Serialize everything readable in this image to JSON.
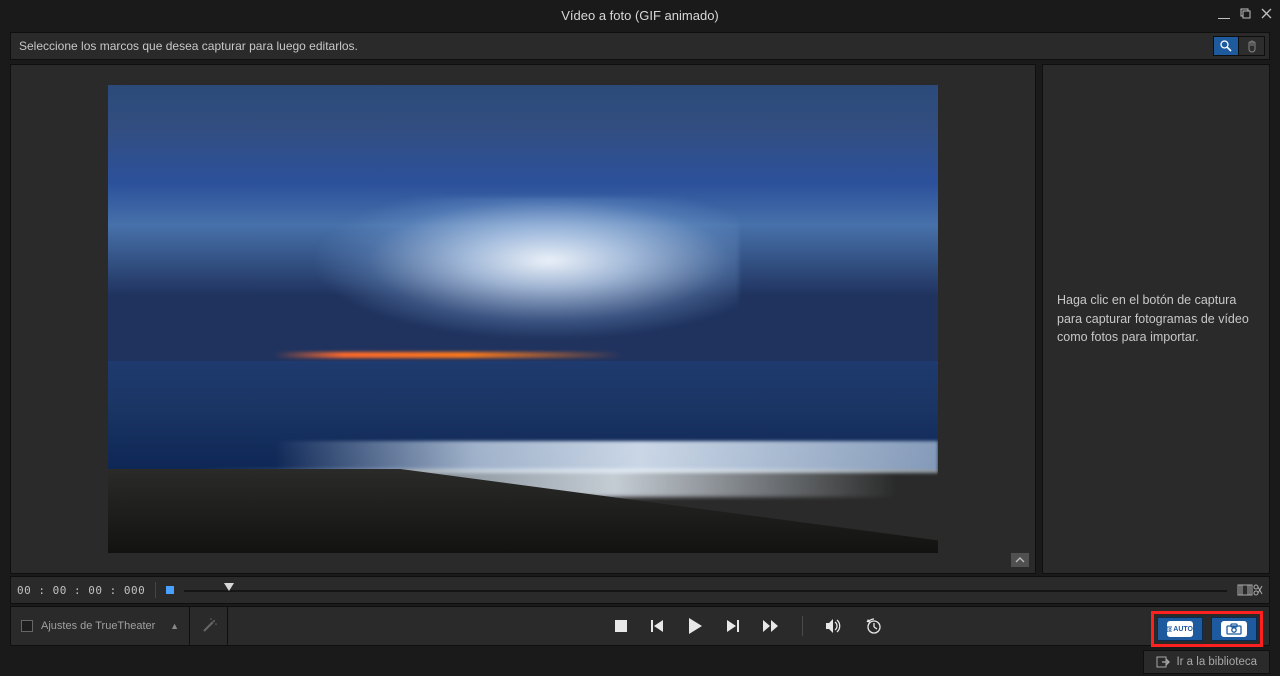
{
  "window": {
    "title": "Vídeo a foto (GIF animado)"
  },
  "instruction_bar": {
    "text": "Seleccione los marcos que desea capturar para luego editarlos."
  },
  "side_panel": {
    "help_text": "Haga clic en el botón de captura para capturar fotogramas de vídeo como fotos para importar."
  },
  "timeline": {
    "timecode": "00 : 00 : 00 : 000"
  },
  "truetheater": {
    "label": "Ajustes de TrueTheater"
  },
  "capture": {
    "auto_label": "AUTO"
  },
  "footer": {
    "library_label": "Ir a la biblioteca"
  }
}
